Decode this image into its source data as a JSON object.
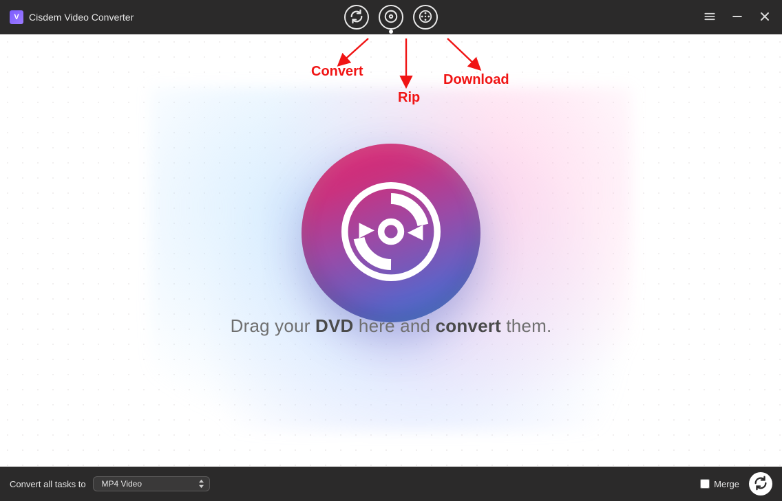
{
  "app": {
    "title": "Cisdem Video Converter",
    "icon_letter": "V"
  },
  "tabs": {
    "convert_name": "convert-tab",
    "rip_name": "rip-tab",
    "download_name": "download-tab",
    "active": "rip"
  },
  "annotations": {
    "convert": "Convert",
    "rip": "Rip",
    "download": "Download"
  },
  "main": {
    "drag_prefix": "Drag your ",
    "drag_bold1": "DVD",
    "drag_mid": " here and ",
    "drag_bold2": "convert",
    "drag_suffix": " them."
  },
  "footer": {
    "label": "Convert all tasks to",
    "selected_format": "MP4 Video",
    "merge_label": "Merge",
    "merge_checked": false
  },
  "colors": {
    "annotation": "#f01414",
    "bar": "#2b2a2a",
    "emblem_top": "#e0246f",
    "emblem_bottom": "#3f7ed4"
  }
}
